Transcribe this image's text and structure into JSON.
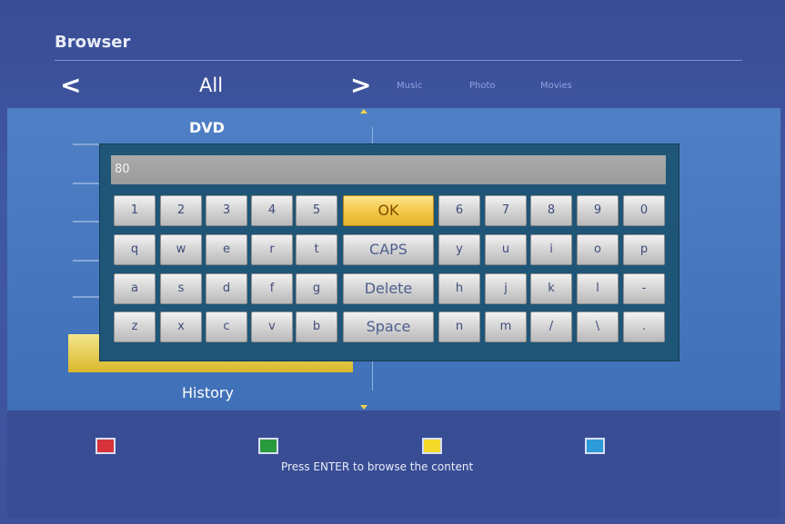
{
  "header": {
    "title": "Browser",
    "current_category": "All",
    "other_categories": [
      "Music",
      "Photo",
      "Movies"
    ],
    "prev_arrow": "<",
    "next_arrow": ">"
  },
  "list": {
    "top_item": "DVD",
    "bottom_item": "History"
  },
  "keyboard": {
    "input_value": "80",
    "rows": [
      [
        "1",
        "2",
        "3",
        "4",
        "5",
        "OK",
        "6",
        "7",
        "8",
        "9",
        "0"
      ],
      [
        "q",
        "w",
        "e",
        "r",
        "t",
        "CAPS",
        "y",
        "u",
        "i",
        "o",
        "p"
      ],
      [
        "a",
        "s",
        "d",
        "f",
        "g",
        "Delete",
        "h",
        "j",
        "k",
        "l",
        "-"
      ],
      [
        "z",
        "x",
        "c",
        "v",
        "b",
        "Space",
        "n",
        "m",
        "/",
        "\\",
        "."
      ]
    ]
  },
  "footer": {
    "hint": "Press ENTER to browse the content",
    "color_keys": [
      {
        "name": "red",
        "color": "#d8323a"
      },
      {
        "name": "green",
        "color": "#2a9b3c"
      },
      {
        "name": "yellow",
        "color": "#f2d92a"
      },
      {
        "name": "blue",
        "color": "#2c9bd8"
      }
    ]
  }
}
